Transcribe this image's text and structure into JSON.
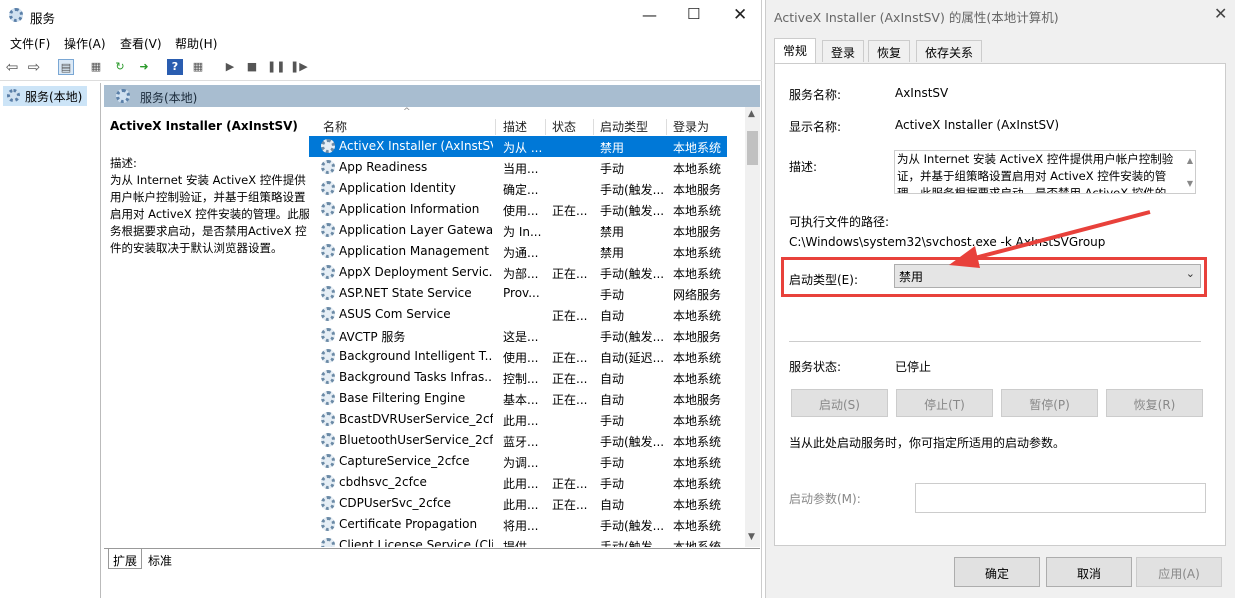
{
  "services_window": {
    "title": "服务",
    "menu": [
      "文件(F)",
      "操作(A)",
      "查看(V)",
      "帮助(H)"
    ],
    "tree_root": "服务(本地)",
    "header_band": "服务(本地)",
    "detail_title": "ActiveX Installer (AxInstSV)",
    "detail_desc_label": "描述:",
    "detail_desc": "为从 Internet 安装 ActiveX 控件提供用户帐户控制验证，并基于组策略设置启用对 ActiveX 控件安装的管理。此服务根据要求启动，是否禁用ActiveX 控件的安装取决于默认浏览器设置。",
    "columns": [
      "名称",
      "描述",
      "状态",
      "启动类型",
      "登录为"
    ],
    "rows": [
      {
        "name": "ActiveX Installer (AxInstSV)",
        "desc": "为从 ...",
        "status": "",
        "startup": "禁用",
        "logon": "本地系统"
      },
      {
        "name": "App Readiness",
        "desc": "当用...",
        "status": "",
        "startup": "手动",
        "logon": "本地系统"
      },
      {
        "name": "Application Identity",
        "desc": "确定...",
        "status": "",
        "startup": "手动(触发...",
        "logon": "本地服务"
      },
      {
        "name": "Application Information",
        "desc": "使用...",
        "status": "正在...",
        "startup": "手动(触发...",
        "logon": "本地系统"
      },
      {
        "name": "Application Layer Gatewa...",
        "desc": "为 In...",
        "status": "",
        "startup": "禁用",
        "logon": "本地服务"
      },
      {
        "name": "Application Management",
        "desc": "为通...",
        "status": "",
        "startup": "禁用",
        "logon": "本地系统"
      },
      {
        "name": "AppX Deployment Servic...",
        "desc": "为部...",
        "status": "正在...",
        "startup": "手动(触发...",
        "logon": "本地系统"
      },
      {
        "name": "ASP.NET State Service",
        "desc": "Prov...",
        "status": "",
        "startup": "手动",
        "logon": "网络服务"
      },
      {
        "name": "ASUS Com Service",
        "desc": "",
        "status": "正在...",
        "startup": "自动",
        "logon": "本地系统"
      },
      {
        "name": "AVCTP 服务",
        "desc": "这是...",
        "status": "",
        "startup": "手动(触发...",
        "logon": "本地服务"
      },
      {
        "name": "Background Intelligent T...",
        "desc": "使用...",
        "status": "正在...",
        "startup": "自动(延迟...",
        "logon": "本地系统"
      },
      {
        "name": "Background Tasks Infras...",
        "desc": "控制...",
        "status": "正在...",
        "startup": "自动",
        "logon": "本地系统"
      },
      {
        "name": "Base Filtering Engine",
        "desc": "基本...",
        "status": "正在...",
        "startup": "自动",
        "logon": "本地服务"
      },
      {
        "name": "BcastDVRUserService_2cf...",
        "desc": "此用...",
        "status": "",
        "startup": "手动",
        "logon": "本地系统"
      },
      {
        "name": "BluetoothUserService_2cf...",
        "desc": "蓝牙...",
        "status": "",
        "startup": "手动(触发...",
        "logon": "本地系统"
      },
      {
        "name": "CaptureService_2cfce",
        "desc": "为调...",
        "status": "",
        "startup": "手动",
        "logon": "本地系统"
      },
      {
        "name": "cbdhsvc_2cfce",
        "desc": "此用...",
        "status": "正在...",
        "startup": "手动",
        "logon": "本地系统"
      },
      {
        "name": "CDPUserSvc_2cfce",
        "desc": "此用...",
        "status": "正在...",
        "startup": "自动",
        "logon": "本地系统"
      },
      {
        "name": "Certificate Propagation",
        "desc": "将用...",
        "status": "",
        "startup": "手动(触发...",
        "logon": "本地系统"
      },
      {
        "name": "Client License Service (Cli...",
        "desc": "提供...",
        "status": "",
        "startup": "手动(触发...",
        "logon": "本地系统"
      }
    ],
    "tabs": [
      "扩展",
      "标准"
    ]
  },
  "dialog": {
    "title": "ActiveX Installer (AxInstSV) 的属性(本地计算机)",
    "tabs": [
      "常规",
      "登录",
      "恢复",
      "依存关系"
    ],
    "service_name_label": "服务名称:",
    "service_name": "AxInstSV",
    "display_name_label": "显示名称:",
    "display_name": "ActiveX Installer (AxInstSV)",
    "desc_label": "描述:",
    "desc": "为从 Internet 安装 ActiveX 控件提供用户帐户控制验证，并基于组策略设置启用对 ActiveX 控件安装的管理。此服务根据要求启动，是否禁用 ActiveX 控件的",
    "path_label": "可执行文件的路径:",
    "path": "C:\\Windows\\system32\\svchost.exe -k AxInstSVGroup",
    "startup_label": "启动类型(E):",
    "startup_value": "禁用",
    "status_label": "服务状态:",
    "status_value": "已停止",
    "buttons": [
      "启动(S)",
      "停止(T)",
      "暂停(P)",
      "恢复(R)"
    ],
    "hint": "当从此处启动服务时，你可指定所适用的启动参数。",
    "param_label": "启动参数(M):",
    "param_value": "",
    "ok": "确定",
    "cancel": "取消",
    "apply": "应用(A)"
  },
  "colors": {
    "selection": "#0078d7",
    "highlight": "#e8413b"
  }
}
